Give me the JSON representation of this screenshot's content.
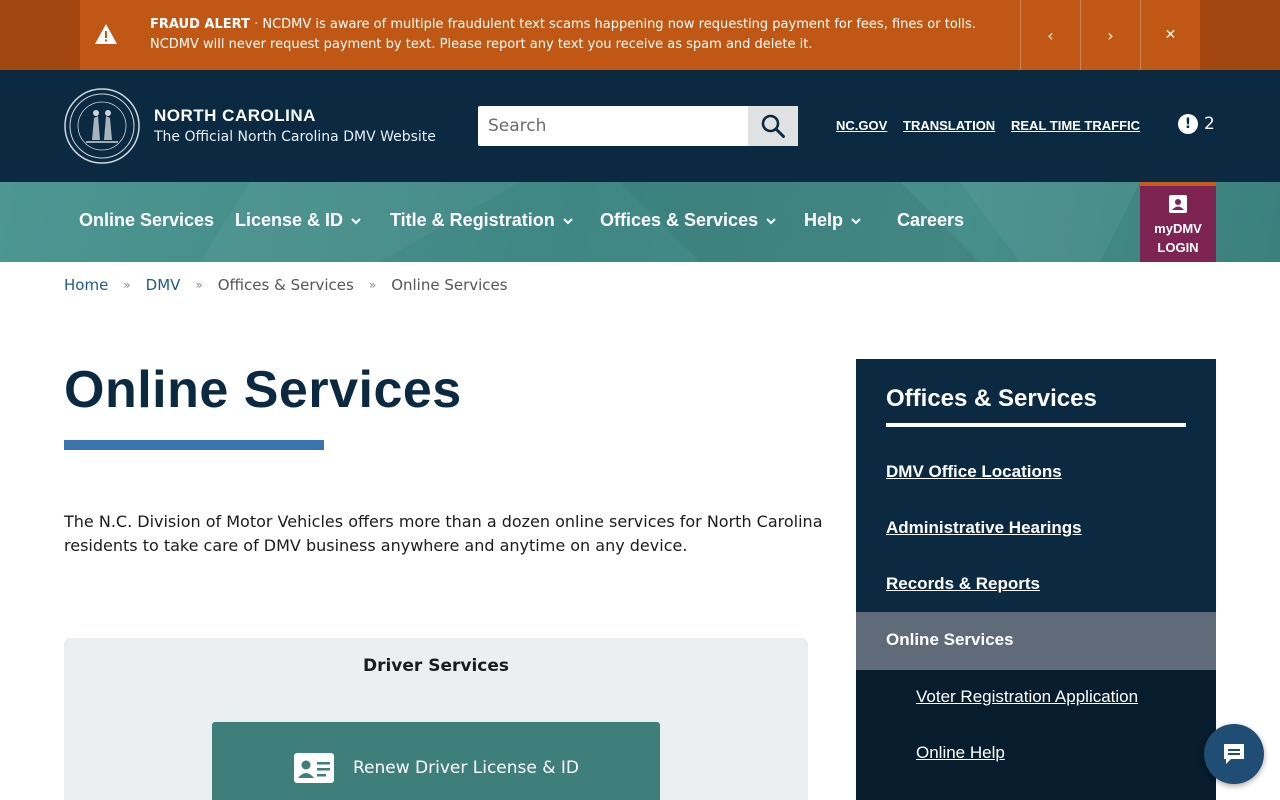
{
  "alert": {
    "title": "FRAUD ALERT",
    "separator": " · ",
    "message": "NCDMV is aware of multiple fraudulent text scams happening now requesting payment for fees, fines or tolls. NCDMV will never request payment by text. Please report any text you receive as spam and delete it.",
    "prev_glyph": "‹",
    "next_glyph": "›",
    "close_glyph": "✕"
  },
  "header": {
    "brand_top": "NORTH CAROLINA",
    "brand_sub": "The Official North Carolina DMV Website",
    "search_placeholder": "Search",
    "links": [
      "NC.GOV",
      "TRANSLATION",
      "REAL TIME TRAFFIC"
    ],
    "alert_count": "2",
    "alert_glyph": "!"
  },
  "nav": {
    "items": [
      "Online Services",
      "License & ID",
      "Title & Registration",
      "Offices & Services",
      "Help",
      "Careers"
    ],
    "login_line1": "myDMV",
    "login_line2": "LOGIN"
  },
  "breadcrumb": {
    "items": [
      "Home",
      "DMV",
      "Offices & Services",
      "Online Services"
    ],
    "separator": "»"
  },
  "main": {
    "title": "Online Services",
    "intro": "The N.C. Division of Motor Vehicles offers more than a dozen online services for North Carolina residents to take care of DMV business anywhere and anytime on any device.",
    "card_title": "Driver Services",
    "card_button": "Renew Driver License & ID"
  },
  "sidebar": {
    "title": "Offices & Services",
    "links": [
      "DMV Office Locations",
      "Administrative Hearings",
      "Records & Reports"
    ],
    "active": "Online Services",
    "sub_links": [
      "Voter Registration Application",
      "Online Help"
    ]
  },
  "colors": {
    "alert_bg": "#c15714",
    "header_bg": "#0b2a42",
    "nav_bg": "#3f8784",
    "login_bg": "#7e2453",
    "title_rule": "#3a73ad",
    "card_button": "#3e7f7c"
  }
}
